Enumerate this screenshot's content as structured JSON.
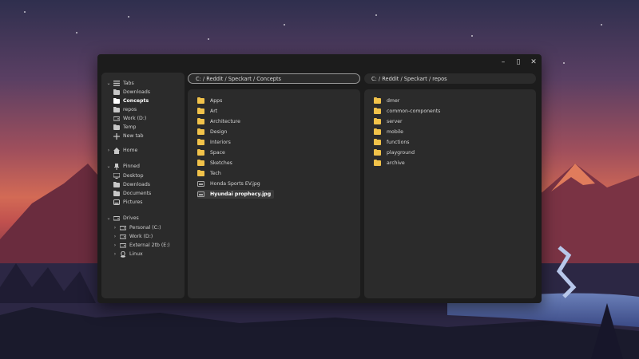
{
  "window": {
    "controls": {
      "minimize": "–",
      "maximize": "▯",
      "close": "✕"
    }
  },
  "sidebar": {
    "tabs": {
      "label": "Tabs",
      "items": [
        "Downloads",
        "Concepts",
        "repos",
        "Work (D:)",
        "Temp",
        "New tab"
      ],
      "active": "Concepts"
    },
    "home": "Home",
    "pinned": {
      "label": "Pinned",
      "items": [
        "Desktop",
        "Downloads",
        "Documents",
        "Pictures"
      ]
    },
    "drives": {
      "label": "Drives",
      "items": [
        "Personal (C:)",
        "Work (D:)",
        "External 2tb (E:)",
        "Linux"
      ]
    }
  },
  "left_pane": {
    "path": "C: / Reddit / Speckart / Concepts",
    "items": [
      {
        "name": "Apps",
        "type": "folder"
      },
      {
        "name": "Art",
        "type": "folder"
      },
      {
        "name": "Architecture",
        "type": "folder"
      },
      {
        "name": "Design",
        "type": "folder"
      },
      {
        "name": "Interiors",
        "type": "folder"
      },
      {
        "name": "Space",
        "type": "folder"
      },
      {
        "name": "Sketches",
        "type": "folder"
      },
      {
        "name": "Tech",
        "type": "folder"
      },
      {
        "name": "Honda Sports EV.jpg",
        "type": "image"
      },
      {
        "name": "Hyundai prophecy.jpg",
        "type": "image",
        "selected": true
      }
    ]
  },
  "right_pane": {
    "path": "C: / Reddit / Speckart / repos",
    "items": [
      {
        "name": "dmer",
        "type": "folder"
      },
      {
        "name": "common-components",
        "type": "folder"
      },
      {
        "name": "server",
        "type": "folder"
      },
      {
        "name": "mobile",
        "type": "folder"
      },
      {
        "name": "functions",
        "type": "folder"
      },
      {
        "name": "playground",
        "type": "folder"
      },
      {
        "name": "archive",
        "type": "folder"
      }
    ]
  },
  "colors": {
    "folder": "#f1c24a",
    "panel": "#2b2b2b",
    "window": "#1c1c1c"
  }
}
